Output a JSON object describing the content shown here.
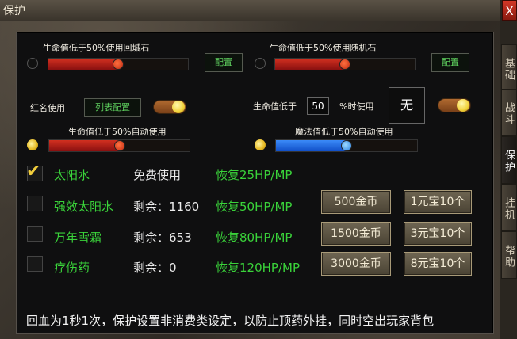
{
  "window": {
    "title": "保护",
    "close_label": "X"
  },
  "side_tabs": [
    "基础",
    "战斗",
    "保护",
    "挂机",
    "帮助"
  ],
  "row1": {
    "left_label": "生命值低于50%使用回城石",
    "left_button": "配置",
    "left_level": 0.5,
    "right_label": "生命值低于50%使用随机石",
    "right_button": "配置",
    "right_level": 0.5
  },
  "row2": {
    "redname_label": "红名使用",
    "list_config": "列表配置",
    "hp_prefix": "生命值低于",
    "hp_value": "50",
    "hp_suffix": "%时使用",
    "item_slot": "无"
  },
  "row3": {
    "hp_label": "生命值低于50%自动使用",
    "hp_level": 0.5,
    "mp_label": "魔法值低于50%自动使用",
    "mp_level": 0.5
  },
  "potions": [
    {
      "name": "太阳水",
      "count": "免费使用",
      "effect": "恢复25HP/MP",
      "checked": true
    },
    {
      "name": "强效太阳水",
      "count": "剩余：1160",
      "effect": "恢复50HP/MP",
      "gold": "500金币",
      "yuanbao": "1元宝10个",
      "checked": false
    },
    {
      "name": "万年雪霜",
      "count": "剩余：653",
      "effect": "恢复80HP/MP",
      "gold": "1500金币",
      "yuanbao": "3元宝10个",
      "checked": false
    },
    {
      "name": "疗伤药",
      "count": "剩余：0",
      "effect": "恢复120HP/MP",
      "gold": "3000金币",
      "yuanbao": "8元宝10个",
      "checked": false
    }
  ],
  "footer": "回血为1秒1次，保护设置非消费类设定，以防止顶药外挂，同时空出玩家背包",
  "colors": {
    "red_fill": "#b81c14",
    "blue_fill": "#1a6ae0",
    "green_text": "#3ad33a"
  }
}
